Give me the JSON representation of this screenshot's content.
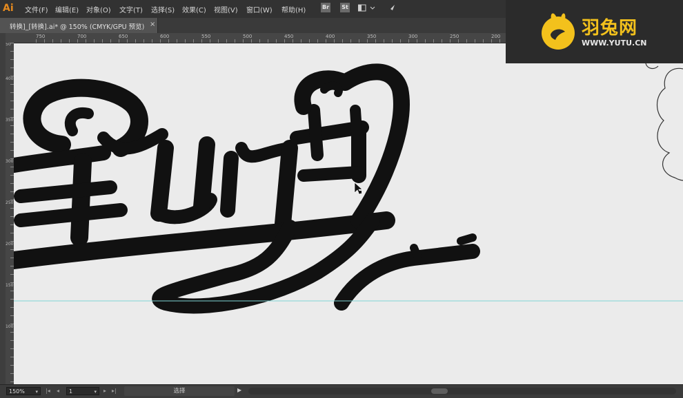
{
  "app": {
    "logo": "Ai"
  },
  "menus": [
    "文件(F)",
    "编辑(E)",
    "对象(O)",
    "文字(T)",
    "选择(S)",
    "效果(C)",
    "视图(V)",
    "窗口(W)",
    "帮助(H)"
  ],
  "app_buttons": [
    "Br",
    "St"
  ],
  "document_tab": {
    "title": "转换]_[转换].ai* @ 150% (CMYK/GPU 预览)",
    "close": "×"
  },
  "ruler_h_labels": [
    "750",
    "700",
    "650",
    "600",
    "550",
    "500",
    "450",
    "400",
    "350",
    "300",
    "250",
    "200"
  ],
  "ruler_v_labels": [
    "50",
    "400",
    "350",
    "300",
    "250",
    "200",
    "150",
    "100"
  ],
  "statusbar": {
    "zoom": "150%",
    "page": "1",
    "tool": "选择"
  },
  "watermark": {
    "name": "羽兔网",
    "url": "WWW.YUTU.CN"
  },
  "colors": {
    "accent_orange": "#e58a1f",
    "watermark_yellow": "#f3c11c",
    "guide_cyan": "#7fd6d6",
    "canvas": "#ebebeb"
  }
}
